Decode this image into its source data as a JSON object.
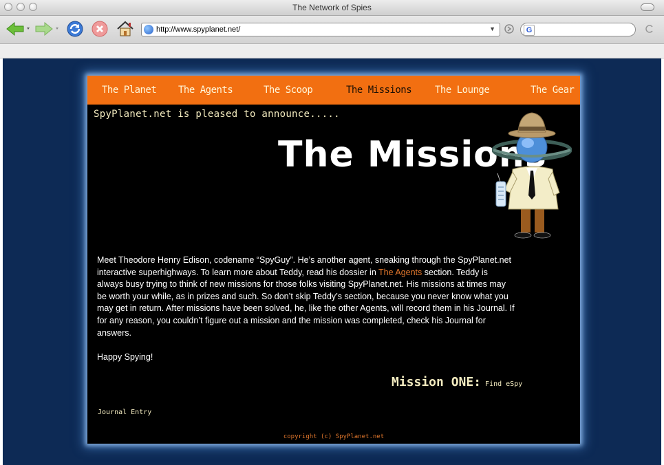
{
  "window": {
    "title": "The Network of Spies"
  },
  "toolbar": {
    "url": "http://www.spyplanet.net/",
    "search_engine_icon": "G"
  },
  "nav": {
    "items": [
      {
        "label": "The Planet",
        "active": false
      },
      {
        "label": "The Agents",
        "active": false
      },
      {
        "label": "The Scoop",
        "active": false
      },
      {
        "label": "The Missions",
        "active": true
      },
      {
        "label": "The Lounge",
        "active": false
      },
      {
        "label": "The Gear",
        "active": false
      }
    ]
  },
  "header": {
    "announce": "SpyPlanet.net is pleased to announce.....",
    "title": "The Missions"
  },
  "content": {
    "intro_part1": "Meet Theodore Henry Edison, codename “SpyGuy”. He’s another agent, sneaking through the SpyPlanet.net interactive superhighways. To learn more about Teddy, read his dossier in ",
    "agents_link": "The Agents",
    "intro_part2": " section. Teddy is always busy trying to think of new missions for those folks visiting SpyPlanet.net. His missions at times may be worth your while, as in prizes and such. So don’t skip Teddy’s section, because you never know what you may get in return. After missions have been solved, he, like the other Agents, will record them in his Journal. If for any reason, you couldn’t figure out a mission and the mission was completed, check his Journal for answers.",
    "signoff": "Happy Spying!"
  },
  "mission": {
    "label": "Mission ONE:",
    "link": "Find eSpy"
  },
  "journal": "Journal Entry",
  "footer": {
    "copyright": "copyright (c) SpyPlanet.net"
  },
  "colors": {
    "nav_bg": "#f26f11",
    "page_bg": "#0d2a55",
    "site_bg": "#000000",
    "accent_link": "#e0762c",
    "cream_text": "#f4ecc0"
  }
}
